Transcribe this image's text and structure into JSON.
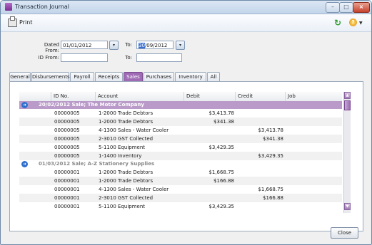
{
  "window": {
    "title": "Transaction Journal"
  },
  "toolbar": {
    "print_label": "Print",
    "help_glyph": "?"
  },
  "filters": {
    "dated_from_label": "Dated From:",
    "dated_from_value": "01/01/2012",
    "to_label": "To:",
    "to_value_selected": "30",
    "to_value_rest": "/09/2012",
    "id_from_label": "ID From:",
    "id_from_value": "",
    "id_to_label": "To:",
    "id_to_value": ""
  },
  "tabs": [
    "General",
    "Disbursements",
    "Payroll",
    "Receipts",
    "Sales",
    "Purchases",
    "Inventory",
    "All"
  ],
  "active_tab": "Sales",
  "grid": {
    "columns": [
      "ID No.",
      "Account",
      "Debit",
      "Credit",
      "Job"
    ],
    "groups": [
      {
        "header": "20/02/2012 Sale; The Motor Company",
        "rows": [
          {
            "id": "00000005",
            "account": "1-2000  Trade Debtors",
            "debit": "$3,413.78",
            "credit": ""
          },
          {
            "id": "00000005",
            "account": "1-2000  Trade Debtors",
            "debit": "$341.38",
            "credit": ""
          },
          {
            "id": "00000005",
            "account": "4-1300  Sales - Water Cooler",
            "debit": "",
            "credit": "$3,413.78"
          },
          {
            "id": "00000005",
            "account": "2-3010  GST Collected",
            "debit": "",
            "credit": "$341.38"
          },
          {
            "id": "00000005",
            "account": "5-1100  Equipment",
            "debit": "$3,429.35",
            "credit": ""
          },
          {
            "id": "00000005",
            "account": "1-1400  Inventory",
            "debit": "",
            "credit": "$3,429.35"
          }
        ]
      },
      {
        "header": "01/03/2012 Sale; A-Z Stationery Supplies",
        "rows": [
          {
            "id": "00000001",
            "account": "1-2000  Trade Debtors",
            "debit": "$1,668.75",
            "credit": ""
          },
          {
            "id": "00000001",
            "account": "1-2000  Trade Debtors",
            "debit": "$166.88",
            "credit": ""
          },
          {
            "id": "00000001",
            "account": "4-1300  Sales - Water Cooler",
            "debit": "",
            "credit": "$1,668.75"
          },
          {
            "id": "00000001",
            "account": "2-3010  GST Collected",
            "debit": "",
            "credit": "$166.88"
          },
          {
            "id": "00000001",
            "account": "5-1100  Equipment",
            "debit": "$3,429.35",
            "credit": ""
          }
        ]
      }
    ]
  },
  "close_label": "Close",
  "colors": {
    "accent": "#a06bb5",
    "group_header": "#b99ac8",
    "refresh": "#2e9a2e"
  }
}
